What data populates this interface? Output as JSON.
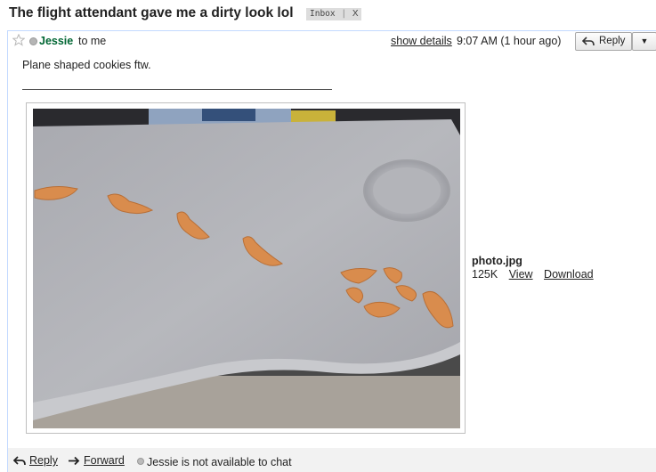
{
  "subject": "The flight attendant gave me a dirty look lol",
  "label": {
    "name": "Inbox",
    "remove": "X"
  },
  "message": {
    "sender": "Jessie",
    "recipient": "to me",
    "show_details": "show details",
    "time": "9:07 AM (1 hour ago)",
    "reply_label": "Reply",
    "more_label": "▼",
    "body": "Plane shaped cookies ftw."
  },
  "attachment": {
    "filename": "photo.jpg",
    "size": "125K",
    "view_label": "View",
    "download_label": "Download"
  },
  "footer": {
    "reply_label": "Reply",
    "forward_label": "Forward",
    "chat_status": "Jessie is not available to chat"
  },
  "colors": {
    "sender": "#006633",
    "card_border": "#c3d9ff",
    "footer_bg": "#f2f2f2",
    "label_bg": "#dddddd"
  },
  "icons": [
    "star-icon",
    "reply-arrow-icon",
    "dropdown-arrow-icon",
    "forward-arrow-icon",
    "status-dot-icon"
  ]
}
